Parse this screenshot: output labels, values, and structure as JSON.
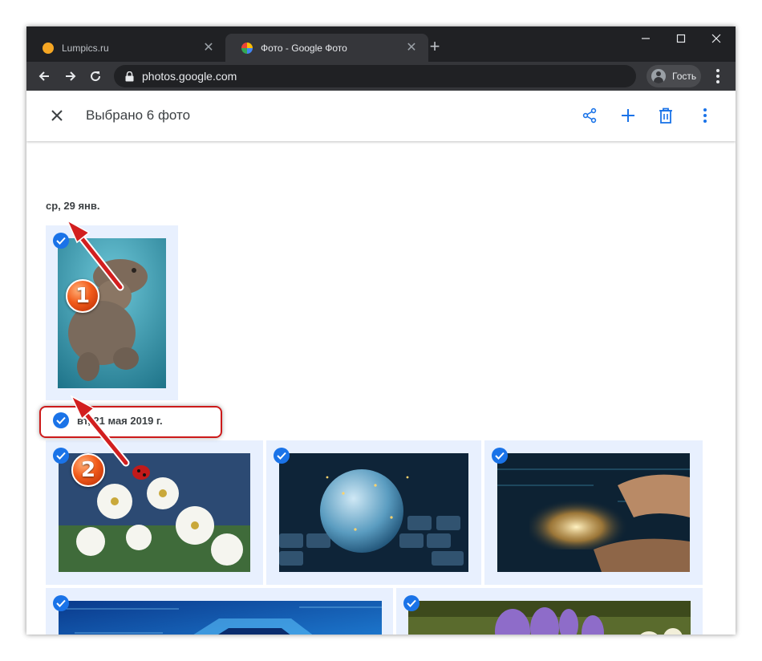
{
  "browser": {
    "tabs": [
      {
        "title": "Lumpics.ru",
        "active": false
      },
      {
        "title": "Фото - Google Фото",
        "active": true
      }
    ],
    "url": "photos.google.com",
    "profile_label": "Гость"
  },
  "appbar": {
    "selection_title": "Выбрано 6 фото"
  },
  "groups": [
    {
      "date": "ср, 29 янв.",
      "photos": [
        {
          "subject": "hippo",
          "selected": true
        }
      ]
    },
    {
      "date": "вт, 21 мая 2019 г.",
      "date_selected": true,
      "photos": [
        {
          "subject": "flowers-ladybug",
          "selected": true
        },
        {
          "subject": "globe-keyboard",
          "selected": true
        },
        {
          "subject": "hand-tablet",
          "selected": true
        },
        {
          "subject": "circuit-chip",
          "selected": true
        },
        {
          "subject": "crocus-flowers",
          "selected": true
        }
      ]
    }
  ],
  "annotations": {
    "marker_1": "1",
    "marker_2": "2"
  },
  "colors": {
    "accent": "#1a73e8",
    "selected_tile": "#e8f0fe",
    "annotation_red": "#cc1a1a",
    "chrome_dark": "#202124"
  }
}
